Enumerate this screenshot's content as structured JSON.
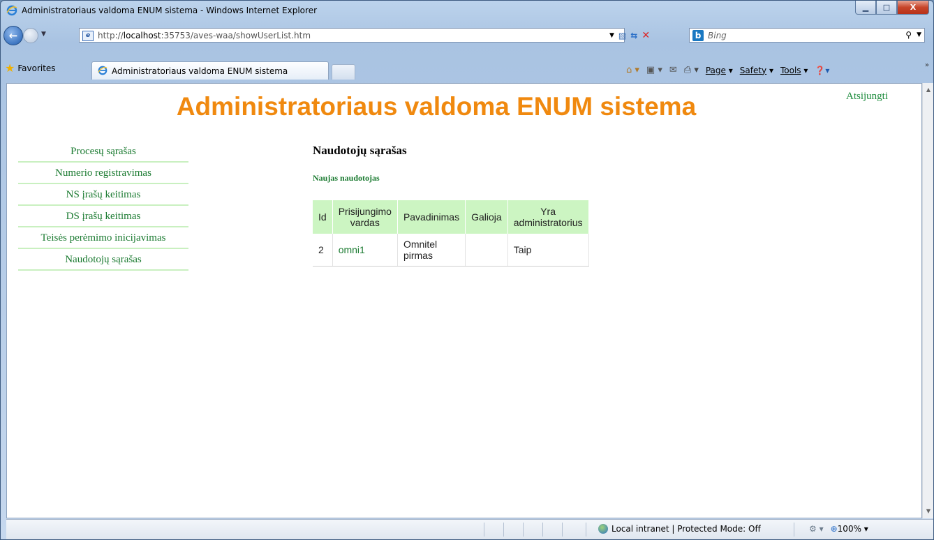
{
  "window": {
    "title": "Administratoriaus valdoma ENUM sistema - Windows Internet Explorer",
    "minimize_glyph": "▁",
    "maximize_glyph": "□",
    "close_glyph": "X"
  },
  "addressbar": {
    "url_prefix": "http://",
    "url_host": "localhost",
    "url_rest": ":35753/aves-waa/showUserList.htm"
  },
  "search": {
    "placeholder": "Bing",
    "bing_glyph": "b"
  },
  "favorites": {
    "label": "Favorites"
  },
  "tab": {
    "label": "Administratoriaus valdoma ENUM sistema"
  },
  "command_bar": {
    "page": "Page",
    "safety": "Safety",
    "tools": "Tools"
  },
  "page": {
    "site_title": "Administratoriaus valdoma ENUM sistema",
    "logout_link": "Atsijungti",
    "menu": [
      "Procesų sąrašas",
      "Numerio registravimas",
      "NS įrašų keitimas",
      "DS įrašų keitimas",
      "Teisės perėmimo inicijavimas",
      "Naudotojų sąrašas"
    ],
    "heading": "Naudotojų sąrašas",
    "new_user_link": "Naujas naudotojas",
    "table": {
      "headers": [
        "Id",
        "Prisijungimo vardas",
        "Pavadinimas",
        "Galioja",
        "Yra administratorius"
      ],
      "rows": [
        {
          "id": "2",
          "login": "omni1",
          "name": "Omnitel pirmas",
          "valid": "",
          "admin": "Taip"
        }
      ]
    }
  },
  "statusbar": {
    "zone": "Local intranet | Protected Mode: Off",
    "zoom": "100%"
  },
  "colors": {
    "site_title": "#f0890f",
    "link_green": "#1a7a30",
    "menu_underline": "#c9f0c0",
    "table_header_bg": "#ccf5c2"
  }
}
